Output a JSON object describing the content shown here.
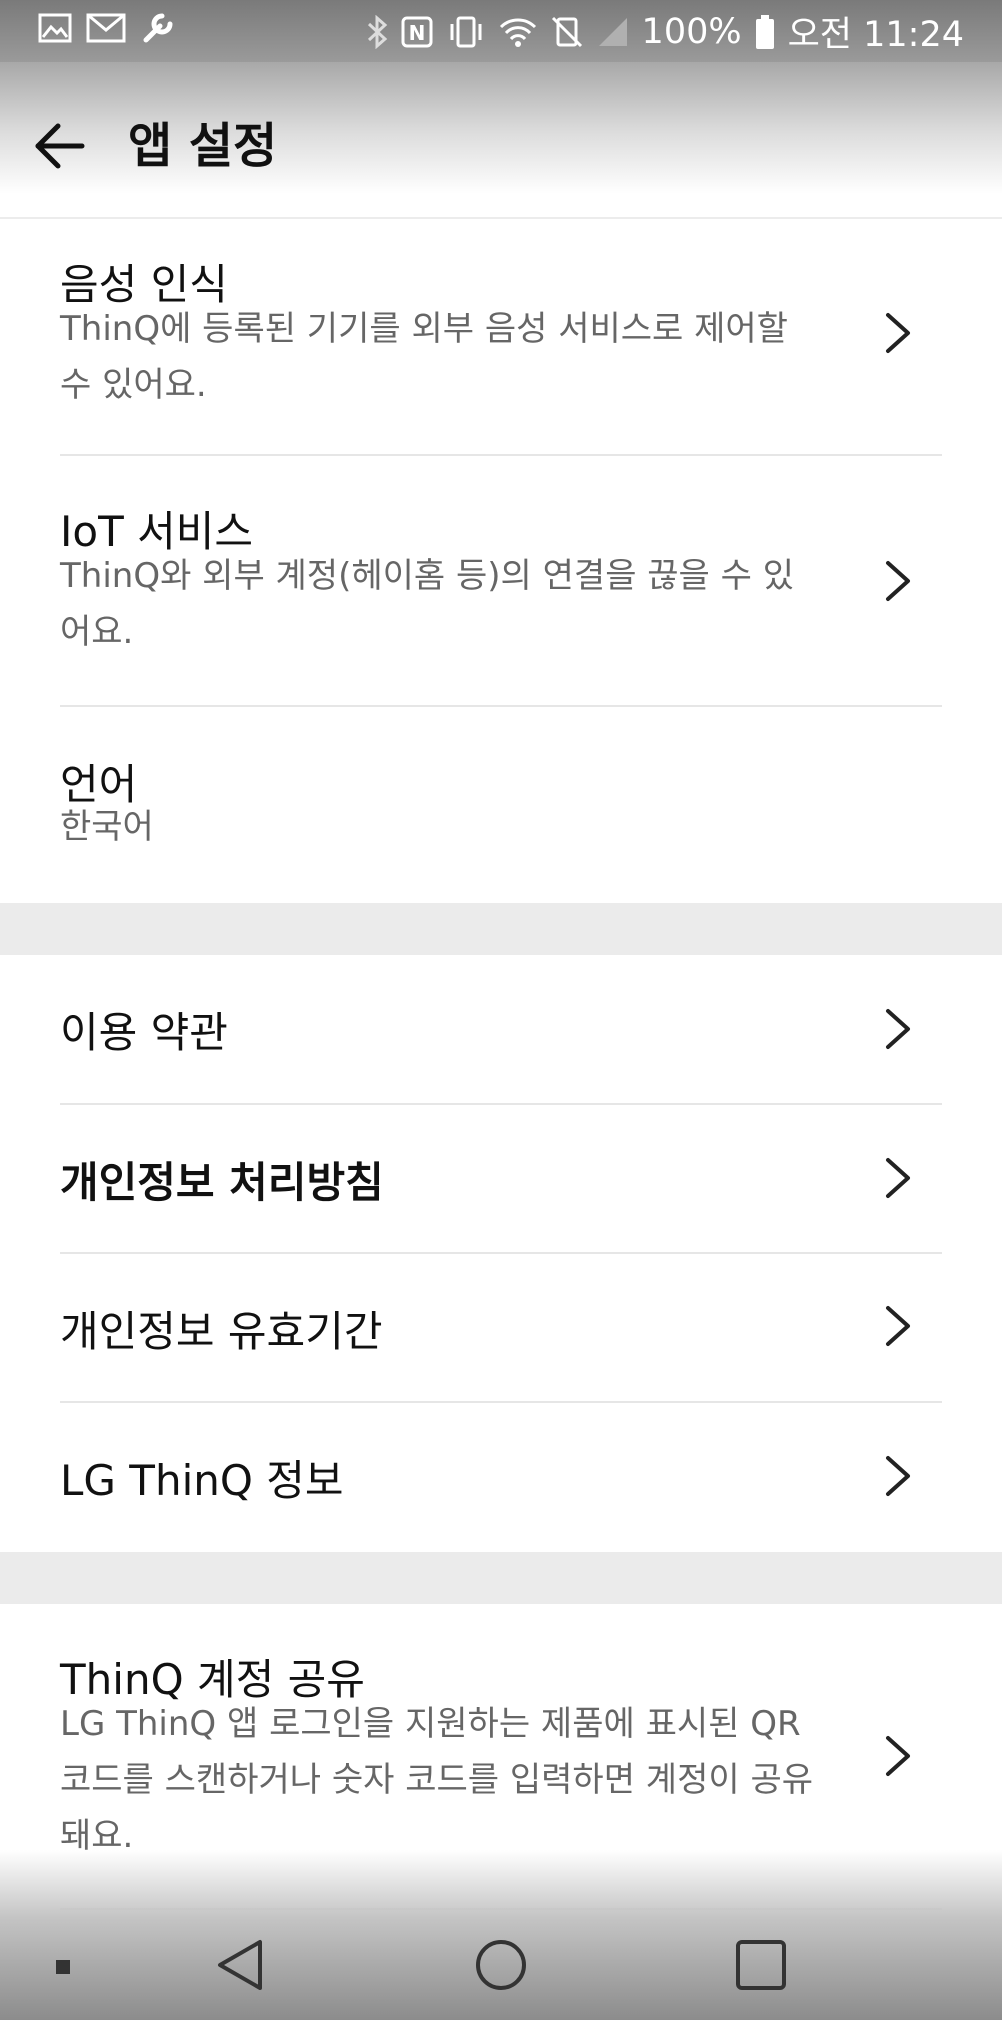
{
  "status_bar": {
    "battery": "100%",
    "time": "오전 11:24",
    "icons": [
      "image-icon",
      "gmail-icon",
      "wrench-icon",
      "bluetooth-icon",
      "nfc-icon",
      "vibrate-icon",
      "wifi-icon",
      "data-off-icon",
      "signal-icon",
      "battery-icon"
    ]
  },
  "header": {
    "title": "앱 설정"
  },
  "section1": {
    "voice": {
      "title": "음성 인식",
      "desc": "ThinQ에 등록된 기기를 외부 음성 서비스로 제어할 수 있어요."
    },
    "iot": {
      "title": "IoT 서비스",
      "desc": "ThinQ와 외부 계정(헤이홈 등)의 연결을 끊을 수 있어요."
    },
    "language": {
      "title": "언어",
      "value": "한국어"
    }
  },
  "section2": {
    "terms": {
      "title": "이용 약관"
    },
    "privacy_policy": {
      "title": "개인정보 처리방침"
    },
    "privacy_period": {
      "title": "개인정보 유효기간"
    },
    "about": {
      "title": "LG ThinQ 정보"
    }
  },
  "section3": {
    "account_share": {
      "title": "ThinQ 계정 공유",
      "desc": "LG ThinQ 앱 로그인을 지원하는 제품에 표시된 QR 코드를 스캔하거나 숫자 코드를 입력하면 계정이 공유돼요."
    }
  }
}
